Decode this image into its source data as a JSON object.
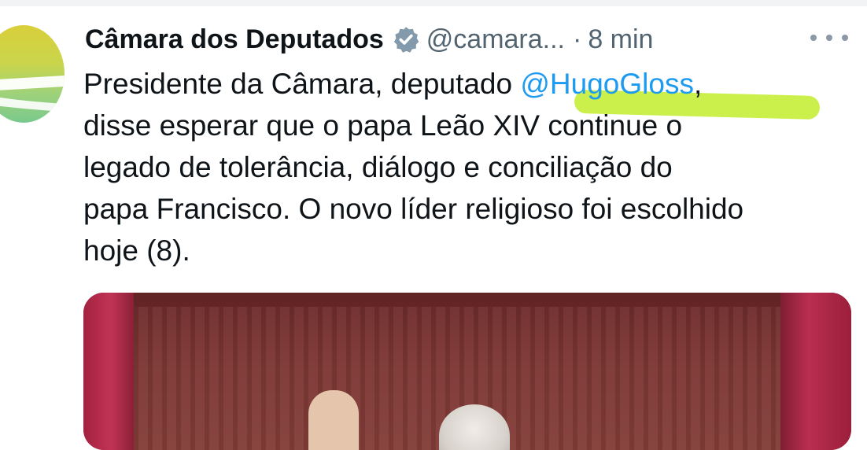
{
  "tweet": {
    "author_name": "Câmara dos Deputados",
    "handle": "@camara...",
    "separator": "·",
    "time": "8 min",
    "text_lines": [
      {
        "before": "Presidente da Câmara, deputado ",
        "mention": "@HugoGloss",
        "after": ","
      },
      "disse esperar que o papa Leão XIV continue o",
      "legado de tolerância, diálogo e conciliação do",
      "papa Francisco. O novo líder religioso foi escolhido",
      "hoje (8)."
    ]
  },
  "icons": {
    "verified": "verified-badge-icon",
    "more": "more-options-icon",
    "avatar": "camara-logo-avatar"
  },
  "colors": {
    "mention": "#1d9bf0",
    "secondary_text": "#536471",
    "highlight": "#c8ef3c"
  }
}
